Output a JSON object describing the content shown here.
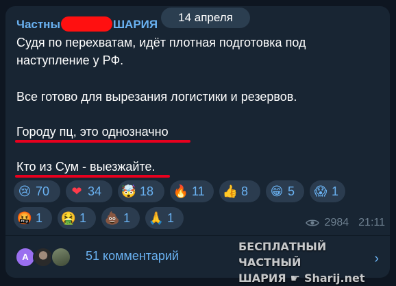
{
  "date_label": "14 апреля",
  "channel": {
    "name_part1": "Частны",
    "name_part2": "ШАРИЯ"
  },
  "message": {
    "line1": "Судя по перехватам, идёт плотная подготовка под",
    "line2": "наступление у РФ.",
    "line3": "Все готово для вырезания логистики и резервов.",
    "line4": "Городу пц,  это однозначно",
    "line5": "Кто из Сум - выезжайте."
  },
  "reactions_row1": [
    {
      "emoji": "😢",
      "count": "70",
      "icon": "crying-face-icon"
    },
    {
      "emoji": "❤",
      "count": "34",
      "icon": "red-heart-icon"
    },
    {
      "emoji": "🤯",
      "count": "18",
      "icon": "exploding-head-icon"
    },
    {
      "emoji": "🔥",
      "count": "11",
      "icon": "fire-icon"
    },
    {
      "emoji": "👍",
      "count": "8",
      "icon": "thumbs-up-icon"
    },
    {
      "emoji": "😁",
      "count": "5",
      "icon": "grinning-face-icon"
    },
    {
      "emoji": "😱",
      "count": "1",
      "icon": "screaming-face-icon"
    }
  ],
  "reactions_row2": [
    {
      "emoji": "🤬",
      "count": "1",
      "icon": "cursing-face-icon"
    },
    {
      "emoji": "🤮",
      "count": "1",
      "icon": "vomiting-face-icon"
    },
    {
      "emoji": "💩",
      "count": "1",
      "icon": "pile-of-poo-icon"
    },
    {
      "emoji": "🙏",
      "count": "1",
      "icon": "folded-hands-icon"
    }
  ],
  "views": "2984",
  "time": "21:11",
  "comments": {
    "avatar_letter": "А",
    "label": "51 комментарий"
  },
  "watermark": {
    "line1": "БЕСПЛАТНЫЙ ЧАСТНЫЙ",
    "line2a": "ШАРИЯ",
    "line2b": "Sharij.net"
  },
  "colors": {
    "accent": "#6ab2f2",
    "bubble": "#182533",
    "background": "#0e1621",
    "underline": "#e8001e"
  }
}
